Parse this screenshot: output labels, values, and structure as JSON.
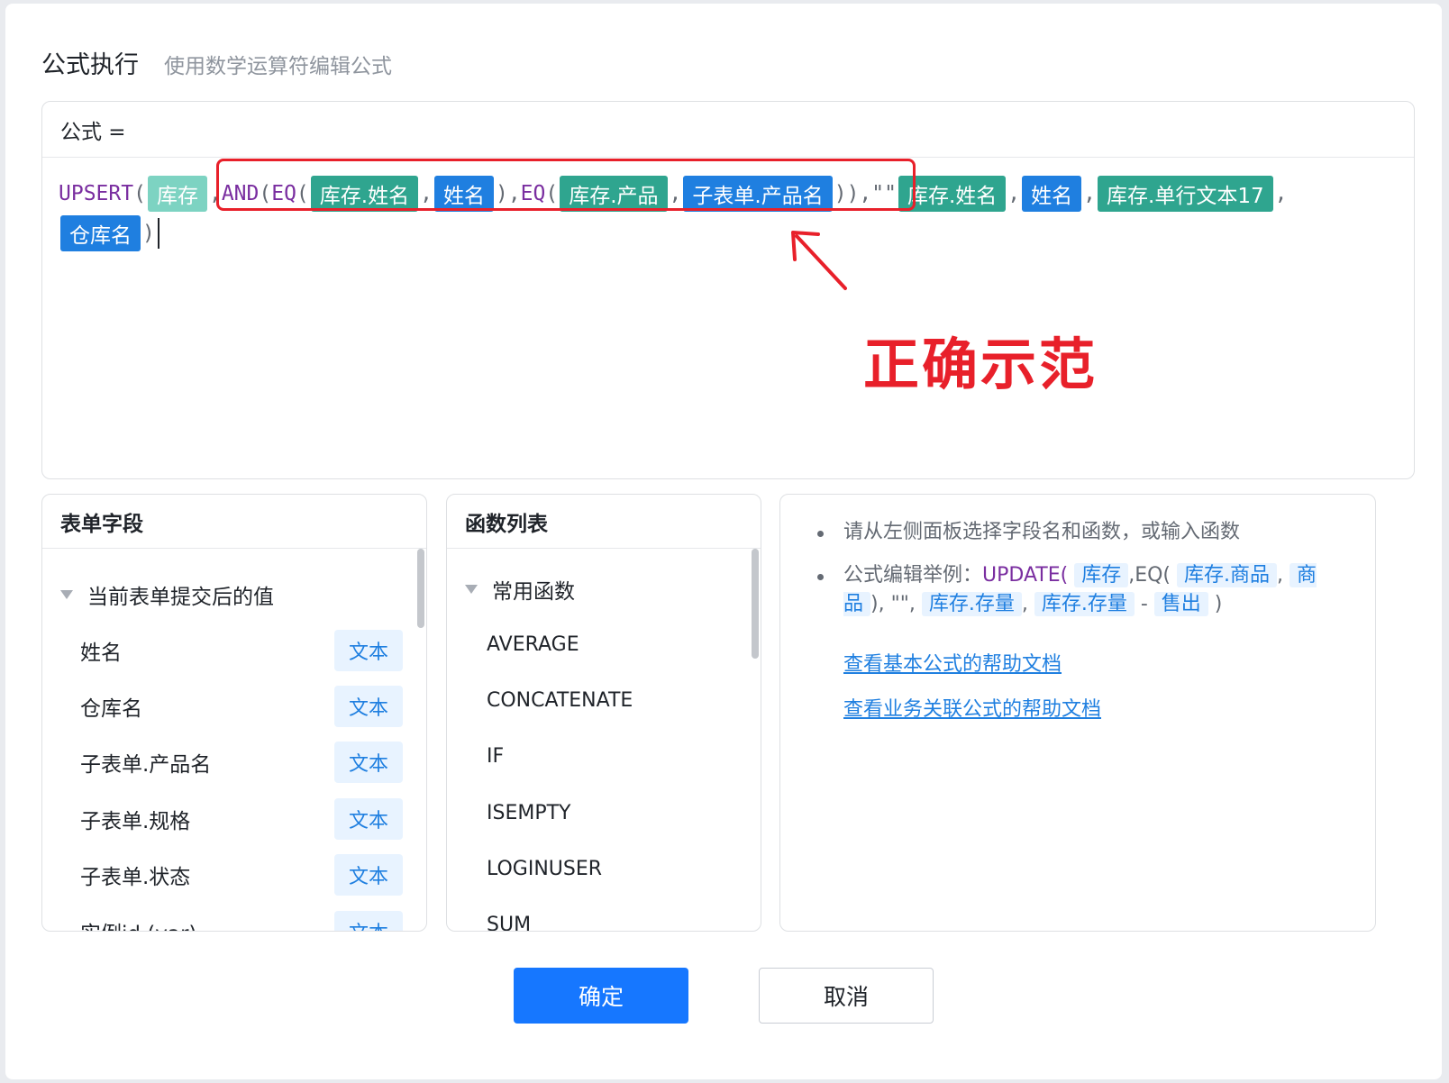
{
  "dialog": {
    "title": "公式执行",
    "subtitle": "使用数学运算符编辑公式"
  },
  "formula": {
    "label": "公式 =",
    "fn_upsert": "UPSERT",
    "fn_and": "AND",
    "fn_eq": "EQ",
    "open": "(",
    "close": ")",
    "comma": ",",
    "dbl_close": "))",
    "empty_str": "\"\"",
    "t_stock": "库存",
    "t_stock_name": "库存.姓名",
    "t_name": "姓名",
    "t_stock_product": "库存.产品",
    "t_sub_product": "子表单.产品名",
    "t_stock_name2": "库存.姓名",
    "t_name2": "姓名",
    "t_stock_text17": "库存.单行文本17",
    "t_warehouse": "仓库名"
  },
  "annotation": {
    "text": "正确示范",
    "color": "#e8202a"
  },
  "form_fields": {
    "title": "表单字段",
    "group": "当前表单提交后的值",
    "items": [
      {
        "name": "姓名",
        "type": "文本"
      },
      {
        "name": "仓库名",
        "type": "文本"
      },
      {
        "name": "子表单.产品名",
        "type": "文本"
      },
      {
        "name": "子表单.规格",
        "type": "文本"
      },
      {
        "name": "子表单.状态",
        "type": "文本"
      },
      {
        "name": "实例id (var)",
        "type": "文本"
      }
    ]
  },
  "functions": {
    "title": "函数列表",
    "group": "常用函数",
    "items": [
      "AVERAGE",
      "CONCATENATE",
      "IF",
      "ISEMPTY",
      "LOGINUSER",
      "SUM"
    ]
  },
  "help": {
    "tip1": "请从左侧面板选择字段名和函数，或输入函数",
    "tip2_prefix": "公式编辑举例：",
    "ex_update": "UPDATE(",
    "ex_stock": "库存",
    "ex_eq": ",EQ(",
    "ex_stock_product": "库存.商品",
    "ex_comma1": ",",
    "ex_product": "商品",
    "ex_mid": "), \"\",",
    "ex_stock_qty": "库存.存量",
    "ex_comma2": ",",
    "ex_stock_qty2": "库存.存量",
    "ex_minus": "-",
    "ex_sold": "售出",
    "ex_end": ")",
    "link1": "查看基本公式的帮助文档",
    "link2": "查看业务关联公式的帮助文档"
  },
  "buttons": {
    "ok": "确定",
    "cancel": "取消"
  },
  "colors": {
    "primary": "#1677ff",
    "form_token": "#2fa58f",
    "field_token": "#1f7fe0",
    "function": "#7a2ea0"
  }
}
